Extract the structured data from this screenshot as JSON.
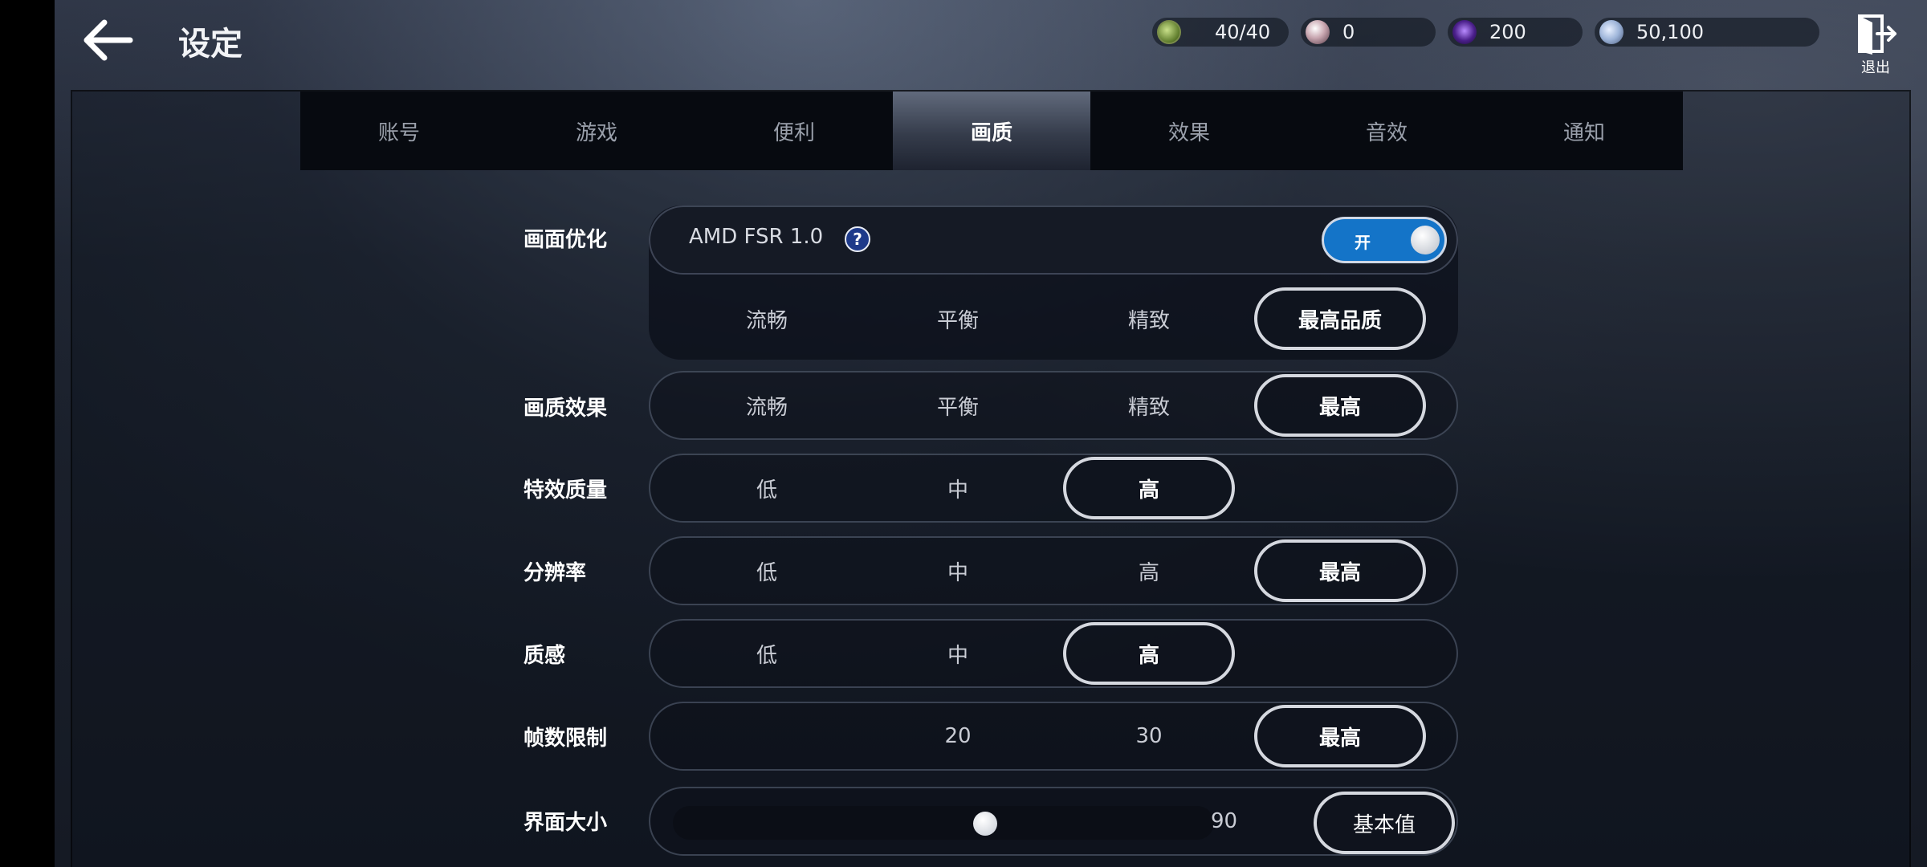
{
  "header": {
    "title": "设定",
    "exit_label": "退出"
  },
  "currencies": [
    {
      "name": "stamina-icon",
      "value": "40/40"
    },
    {
      "name": "pearl-icon",
      "value": "0"
    },
    {
      "name": "orb-icon",
      "value": "200"
    },
    {
      "name": "coin-icon",
      "value": "50,100"
    }
  ],
  "tabs": [
    {
      "label": "账号",
      "active": false
    },
    {
      "label": "游戏",
      "active": false
    },
    {
      "label": "便利",
      "active": false
    },
    {
      "label": "画质",
      "active": true
    },
    {
      "label": "效果",
      "active": false
    },
    {
      "label": "音效",
      "active": false
    },
    {
      "label": "通知",
      "active": false
    }
  ],
  "settings": {
    "screen_optimization": {
      "label": "画面优化",
      "fsr_text": "AMD FSR 1.0",
      "help": "?",
      "toggle_label": "开",
      "toggle_on": true,
      "options": [
        "流畅",
        "平衡",
        "精致",
        "最高品质"
      ],
      "selected": "最高品质"
    },
    "graphics_quality": {
      "label": "画质效果",
      "options": [
        "流畅",
        "平衡",
        "精致",
        "最高"
      ],
      "selected": "最高"
    },
    "effects_quality": {
      "label": "特效质量",
      "options": [
        "低",
        "中",
        "高"
      ],
      "selected": "高"
    },
    "resolution": {
      "label": "分辨率",
      "options": [
        "低",
        "中",
        "高",
        "最高"
      ],
      "selected": "最高"
    },
    "texture": {
      "label": "质感",
      "options": [
        "低",
        "中",
        "高"
      ],
      "selected": "高"
    },
    "frame_limit": {
      "label": "帧数限制",
      "options": [
        "20",
        "30",
        "最高"
      ],
      "selected": "最高"
    },
    "ui_size": {
      "label": "界面大小",
      "value": "90",
      "level_fraction": 0.58,
      "reset_label": "基本值"
    }
  },
  "colors": {
    "accent_toggle": "#1474c8",
    "selected_border": "#d5d8df"
  }
}
